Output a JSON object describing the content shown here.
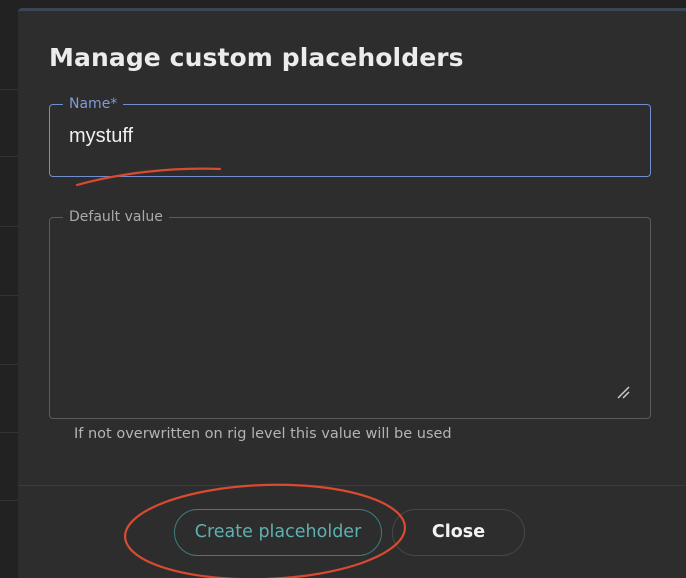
{
  "dialog": {
    "title": "Manage custom placeholders"
  },
  "name_field": {
    "label": "Name*",
    "value": "mystuff"
  },
  "default_value_field": {
    "label": "Default value",
    "value": ""
  },
  "helper_text": "If not overwritten on rig level this value will be used",
  "buttons": {
    "create_label": "Create placeholder",
    "close_label": "Close"
  },
  "colors": {
    "focus_accent": "#6f8fd0",
    "create_accent": "#5fb0b0",
    "annotation": "#d94a32"
  }
}
